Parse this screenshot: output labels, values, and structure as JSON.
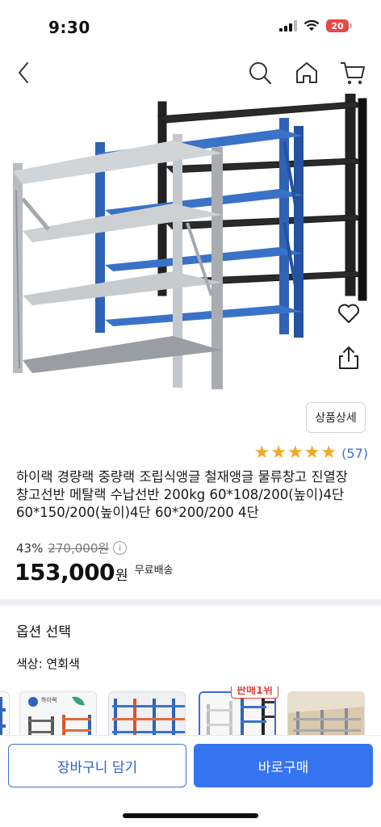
{
  "status": {
    "time": "9:30",
    "battery": "20"
  },
  "nav": {
    "back": "back-icon",
    "search": "search-icon",
    "home": "home-icon",
    "cart": "cart-icon"
  },
  "product": {
    "detail_button": "상품상세",
    "rating_stars": 5,
    "review_count": "(57)",
    "title": "하이랙 경량랙 중량랙 조립식앵글 철재앵글 물류창고 진열장 창고선반 메탈랙 수납선반 200kg 60*108/200(높이)4단 60*150/200(높이)4단 60*200/200 4단",
    "discount": "43%",
    "original_price": "270,000원",
    "price": "153,000",
    "currency": "원",
    "shipping": "무료배송"
  },
  "options": {
    "title": "옵션 선택",
    "color_label": "색상: 연회색",
    "bestseller_badge": "판매1위"
  },
  "bottom": {
    "cart_button": "장바구니 담기",
    "buy_button": "바로구매"
  },
  "colors": {
    "accent": "#3574f0",
    "star": "#f6a623",
    "badge": "#e0413a",
    "battery": "#e24a4a"
  }
}
